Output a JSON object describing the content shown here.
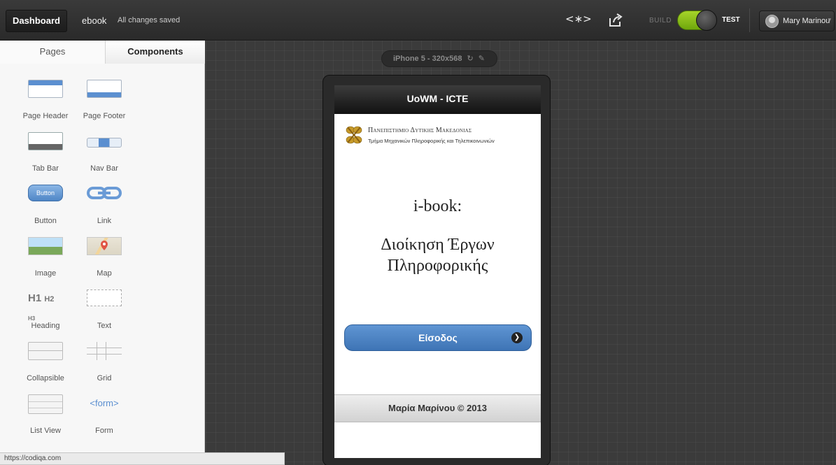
{
  "topbar": {
    "dashboard_label": "Dashboard",
    "project_name": "ebook",
    "save_status": "All changes saved",
    "code_icon": "code-icon",
    "share_icon": "share-icon",
    "build_label": "BUILD",
    "test_label": "TEST",
    "mode": "test",
    "user_name": "Mary Marinou",
    "user_caret": "▾"
  },
  "sidebar": {
    "tabs": {
      "pages": "Pages",
      "components": "Components"
    },
    "active_tab": "Components",
    "components": [
      {
        "label": "Page Header",
        "icon": "page-header-icon"
      },
      {
        "label": "Page Footer",
        "icon": "page-footer-icon"
      },
      {
        "label": "Tab Bar",
        "icon": "tab-bar-icon"
      },
      {
        "label": "Nav Bar",
        "icon": "nav-bar-icon"
      },
      {
        "label": "Button",
        "icon": "button-icon",
        "icon_text": "Button"
      },
      {
        "label": "Link",
        "icon": "link-icon"
      },
      {
        "label": "Image",
        "icon": "image-icon"
      },
      {
        "label": "Map",
        "icon": "map-icon"
      },
      {
        "label": "Heading",
        "icon": "heading-icon",
        "icon_text": "H1 H2 H3"
      },
      {
        "label": "Text",
        "icon": "text-icon"
      },
      {
        "label": "Collapsible",
        "icon": "collapsible-icon"
      },
      {
        "label": "Grid",
        "icon": "grid-icon"
      },
      {
        "label": "List View",
        "icon": "list-view-icon"
      },
      {
        "label": "Form",
        "icon": "form-icon",
        "icon_text": "<form>"
      }
    ]
  },
  "statusbar": {
    "url": "https://codiqa.com"
  },
  "canvas": {
    "device_label": "iPhone 5 - 320x568",
    "rotate_icon": "rotate-icon",
    "edit_icon": "pencil-icon"
  },
  "mobile": {
    "header_title": "UoWM - ICTE",
    "university_name": "Πανεπιστημιο Δυτικης Μακεδονιας",
    "department": "Τμήμα Μηχανικών Πληροφορικής και Τηλεπικοινωνιών",
    "title": "i-book:",
    "subtitle_line1": "Διοίκηση Έργων",
    "subtitle_line2": "Πληροφορικής",
    "enter_button": "Είσοδος",
    "footer_text": "Μαρία Μαρίνου © 2013"
  },
  "colors": {
    "accent_blue": "#4f86c6",
    "toggle_green": "#8cc21a",
    "canvas_bg": "#3b3b3b"
  }
}
